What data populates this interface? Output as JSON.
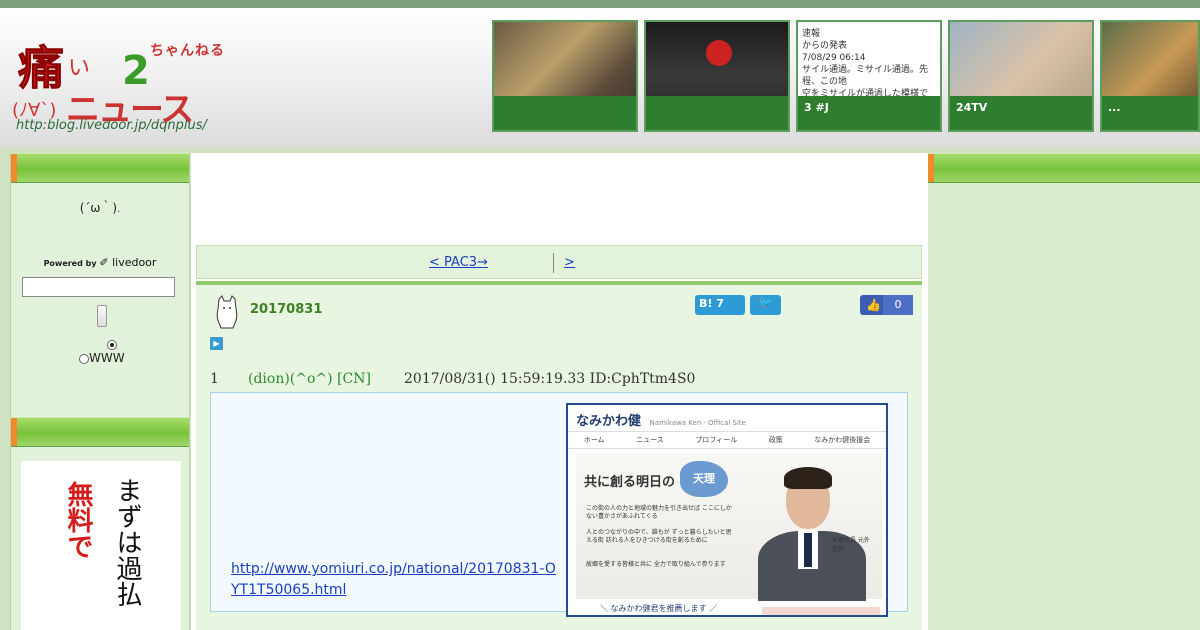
{
  "header": {
    "logo": {
      "kanji": "痛",
      "hiragana_i": "い",
      "number_two": "2",
      "chan": "ちゃんねる",
      "news": "ニュース",
      "face": "(ﾉ∀`)",
      "url": "http:blog.livedoor.jp/dqnplus/"
    },
    "thumbnails": [
      {
        "caption": ""
      },
      {
        "caption": ""
      },
      {
        "caption": "3 #J",
        "text": "速報\nからの発表\n7/08/29 06:14\nサイル通過。ミサイル通過。先程、この地\n空をミサイルが通過した模様です。不審な"
      },
      {
        "caption": "24TV"
      },
      {
        "caption": "..."
      }
    ]
  },
  "sidebar": {
    "face": "(´ω｀)",
    "powered_by": "Powered by",
    "livedoor": "livedoor",
    "search_value": "",
    "radio_www": "WWW",
    "ad": {
      "col1": "無料で",
      "col2": "まずは過払"
    }
  },
  "nav": {
    "prev": "< PAC3→",
    "next": ">"
  },
  "article": {
    "title": "20170831",
    "hatena_count": "7",
    "hatena_label": "B!",
    "fb_count": "0",
    "post": {
      "number": "1",
      "name": "(dion)(^o^) [CN]",
      "date": "2017/08/31() 15:59:19.33 ID:CphTtm4S0"
    },
    "link": "http://www.yomiuri.co.jp/national/20170831-OYT1T50065.html",
    "screenshot": {
      "site_name": "なみかわ健",
      "site_sub": "Namikawa Ken · Offical Site",
      "menu": [
        "ホーム",
        "ニュース",
        "プロフィール",
        "政策",
        "なみかわ健後援会"
      ],
      "slogan": "共に創る明日の",
      "map_label": "天理",
      "p1": "この街の人の力と地域の魅力を引き出せば ここにしかない豊かさがあふれてくる",
      "p2": "人とのつながりの中で、誰もが ずっと暮らしたいと思える街 訪れる人をひきつける街を創るために",
      "p3": "故郷を愛する皆様と共に 全力で取り組んで参ります",
      "person_title": "天理市長 元外交官",
      "bottom": "＼ なみかわ健君を推薦します ／"
    }
  },
  "colors": {
    "accent_green": "#78c23c",
    "link_blue": "#1a3ec2",
    "hatena_blue": "#2e9bd6",
    "facebook_blue": "#3b5cb3"
  }
}
